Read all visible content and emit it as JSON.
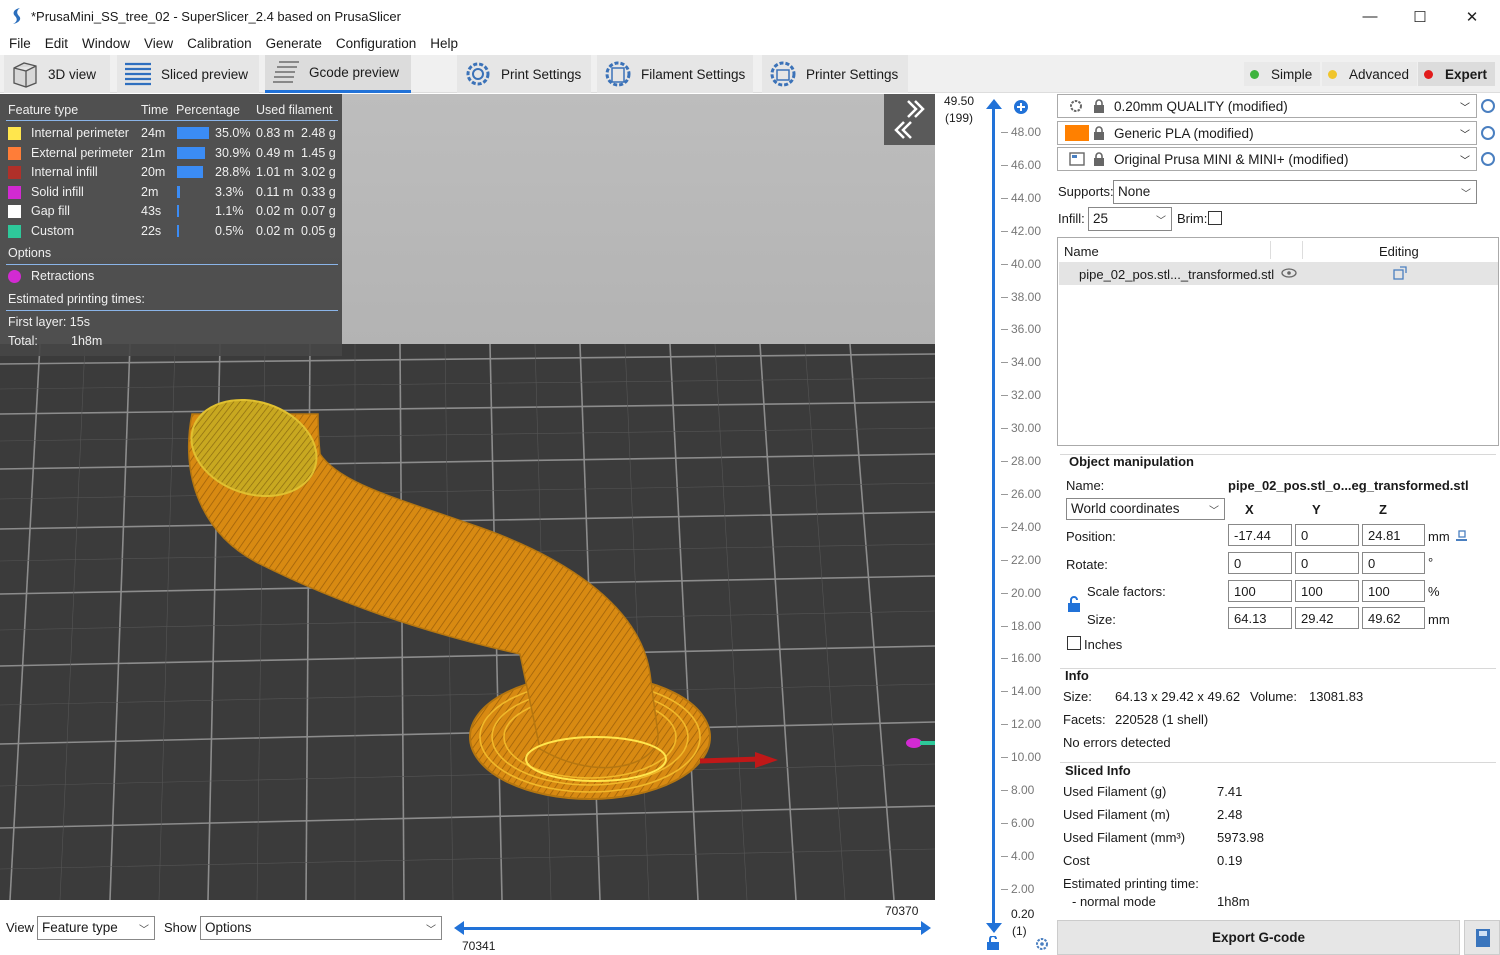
{
  "window": {
    "title": "*PrusaMini_SS_tree_02 - SuperSlicer_2.4  based on PrusaSlicer",
    "minimize": "—",
    "maximize": "☐",
    "close": "✕"
  },
  "menu": [
    "File",
    "Edit",
    "Window",
    "View",
    "Calibration",
    "Generate",
    "Configuration",
    "Help"
  ],
  "toolbar": {
    "view3d": "3D view",
    "sliced": "Sliced preview",
    "gcode": "Gcode preview",
    "print_settings": "Print Settings",
    "filament_settings": "Filament Settings",
    "printer_settings": "Printer Settings",
    "modes": [
      {
        "label": "Simple",
        "color": "#3fb33f"
      },
      {
        "label": "Advanced",
        "color": "#f0c52c"
      },
      {
        "label": "Expert",
        "color": "#e11b1b"
      }
    ]
  },
  "legend": {
    "headers": {
      "type": "Feature type",
      "time": "Time",
      "pct": "Percentage",
      "used": "Used filament"
    },
    "rows": [
      {
        "name": "Internal perimeter",
        "color": "#ffe64d",
        "time": "24m",
        "pct": "35.0%",
        "frac": 0.35,
        "m": "0.83 m",
        "g": "2.48 g"
      },
      {
        "name": "External perimeter",
        "color": "#ff7d38",
        "time": "21m",
        "pct": "30.9%",
        "frac": 0.309,
        "m": "0.49 m",
        "g": "1.45 g"
      },
      {
        "name": "Internal infill",
        "color": "#b03029",
        "time": "20m",
        "pct": "28.8%",
        "frac": 0.288,
        "m": "1.01 m",
        "g": "3.02 g"
      },
      {
        "name": "Solid infill",
        "color": "#d22ad2",
        "time": "2m",
        "pct": "3.3%",
        "frac": 0.033,
        "m": "0.11 m",
        "g": "0.33 g"
      },
      {
        "name": "Gap fill",
        "color": "#ffffff",
        "time": "43s",
        "pct": "1.1%",
        "frac": 0.011,
        "m": "0.02 m",
        "g": "0.07 g"
      },
      {
        "name": "Custom",
        "color": "#2ec89a",
        "time": "22s",
        "pct": "0.5%",
        "frac": 0.005,
        "m": "0.02 m",
        "g": "0.05 g"
      }
    ],
    "options_label": "Options",
    "retractions": "Retractions",
    "retractions_color": "#d22ad2",
    "est_label": "Estimated printing times:",
    "first_layer": "First layer:  15s",
    "total_label": "Total:",
    "total_value": "1h8m"
  },
  "vslider": {
    "top_value": "49.50",
    "top_layer": "(199)",
    "bottom_value": "0.20",
    "bottom_layer": "(1)",
    "ticks": [
      "48.00",
      "46.00",
      "44.00",
      "42.00",
      "40.00",
      "38.00",
      "36.00",
      "34.00",
      "32.00",
      "30.00",
      "28.00",
      "26.00",
      "24.00",
      "22.00",
      "20.00",
      "18.00",
      "16.00",
      "14.00",
      "12.00",
      "10.00",
      "8.00",
      "6.00",
      "4.00",
      "2.00"
    ]
  },
  "hslider": {
    "right_value": "70370",
    "left_value": "70341"
  },
  "bottom": {
    "view_label": "View",
    "view_value": "Feature type",
    "show_label": "Show",
    "show_value": "Options"
  },
  "presets": {
    "print": "0.20mm QUALITY (modified)",
    "filament": "Generic PLA (modified)",
    "filament_color": "#ff8000",
    "printer": "Original Prusa MINI & MINI+ (modified)",
    "supports_label": "Supports:",
    "supports_value": "None",
    "infill_label": "Infill:",
    "infill_value": "25",
    "brim_label": "Brim:"
  },
  "object_list": {
    "col_name": "Name",
    "col_editing": "Editing",
    "item": "pipe_02_pos.stl..._transformed.stl"
  },
  "manipulation": {
    "title": "Object manipulation",
    "name_label": "Name:",
    "name_value": "pipe_02_pos.stl_o...eg_transformed.stl",
    "coords": "World coordinates",
    "x": "X",
    "y": "Y",
    "z": "Z",
    "position_label": "Position:",
    "position": [
      "-17.44",
      "0",
      "24.81"
    ],
    "position_unit": "mm",
    "rotate_label": "Rotate:",
    "rotate": [
      "0",
      "0",
      "0"
    ],
    "rotate_unit": "°",
    "scale_label": "Scale factors:",
    "scale": [
      "100",
      "100",
      "100"
    ],
    "scale_unit": "%",
    "size_label": "Size:",
    "size": [
      "64.13",
      "29.42",
      "49.62"
    ],
    "size_unit": "mm",
    "inches": "Inches"
  },
  "info": {
    "title": "Info",
    "size_label": "Size:",
    "size_value": "64.13 x 29.42 x 49.62",
    "volume_label": "Volume:",
    "volume_value": "13081.83",
    "facets_label": "Facets:",
    "facets_value": "220528 (1 shell)",
    "errors": "No errors detected"
  },
  "sliced_info": {
    "title": "Sliced Info",
    "rows": [
      {
        "label": "Used Filament (g)",
        "value": "7.41"
      },
      {
        "label": "Used Filament (m)",
        "value": "2.48"
      },
      {
        "label": "Used Filament (mm³)",
        "value": "5973.98"
      },
      {
        "label": "Cost",
        "value": "0.19"
      }
    ],
    "est_label": "Estimated printing time:",
    "mode_label": "- normal mode",
    "mode_value": "1h8m"
  },
  "export": "Export G-code"
}
